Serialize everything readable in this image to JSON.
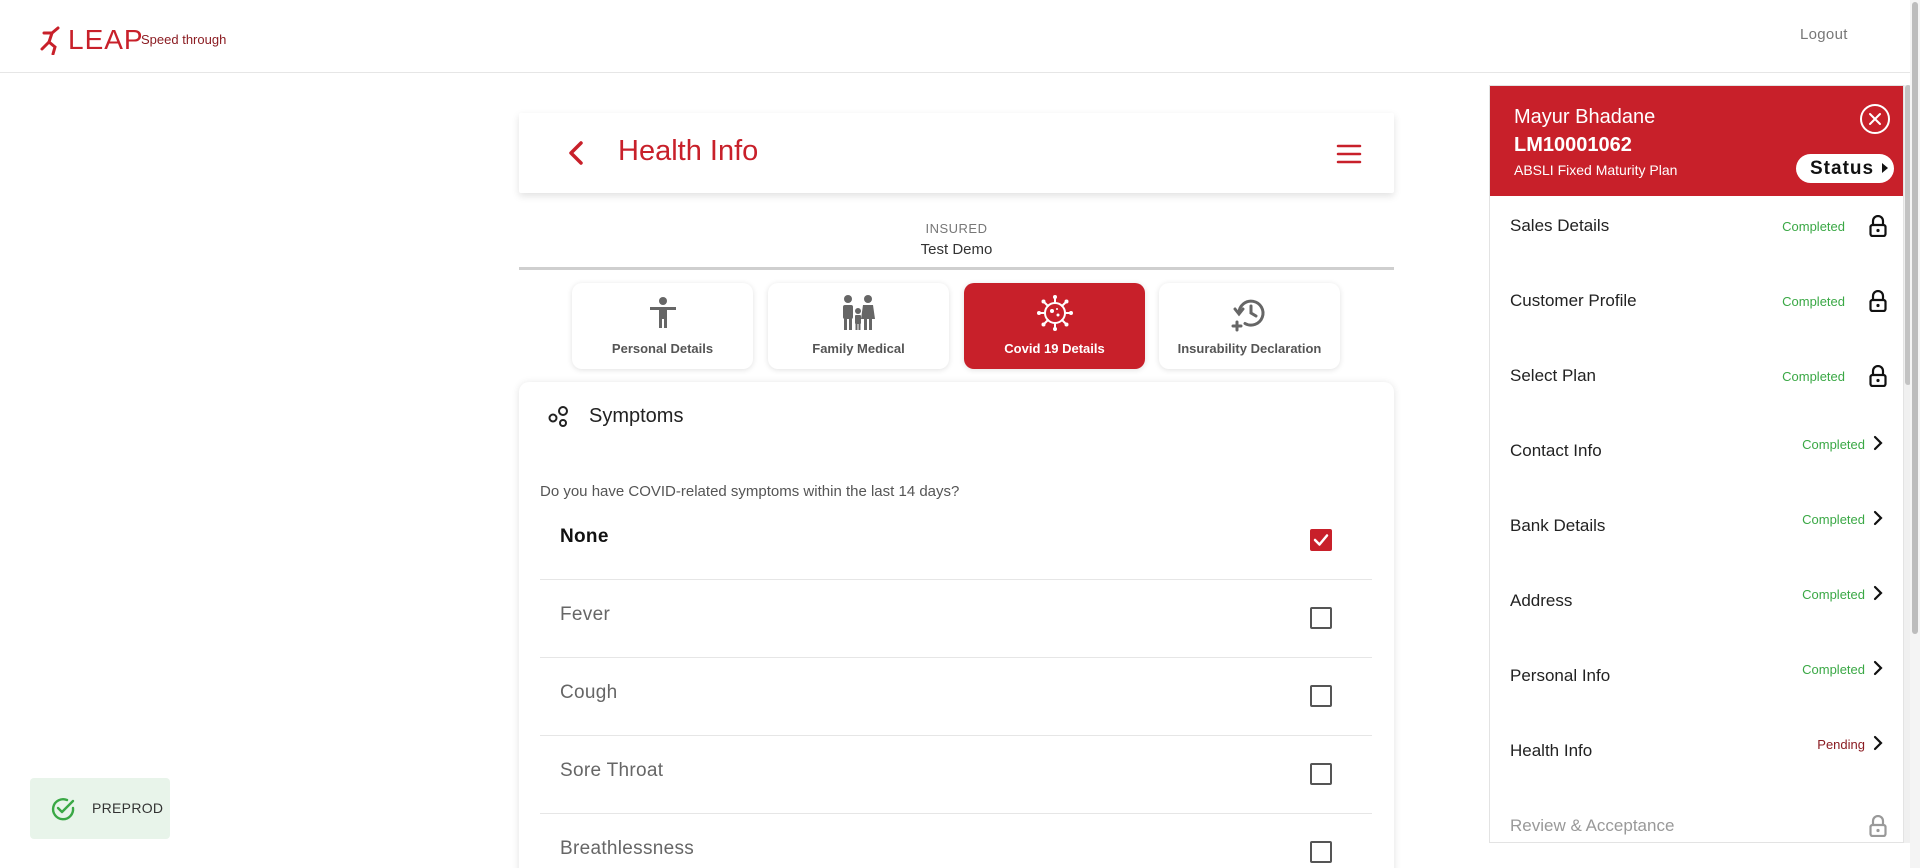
{
  "brand": {
    "name": "LEAP",
    "tagline": "Speed through",
    "accent_color": "#c8202a"
  },
  "header": {
    "logout_label": "Logout"
  },
  "page": {
    "title": "Health Info",
    "back_icon": "chevron-left-icon",
    "menu_icon": "hamburger-menu-icon",
    "insured_label": "INSURED",
    "insured_name": "Test Demo"
  },
  "tabs": [
    {
      "label": "Personal Details",
      "icon": "person-icon",
      "active": false
    },
    {
      "label": "Family Medical",
      "icon": "family-icon",
      "active": false
    },
    {
      "label": "Covid 19 Details",
      "icon": "virus-icon",
      "active": true
    },
    {
      "label": "Insurability Declaration",
      "icon": "history-add-icon",
      "active": false
    }
  ],
  "symptoms": {
    "title": "Symptoms",
    "question": "Do you have COVID-related symptoms within the last 14 days?",
    "options": [
      {
        "label": "None",
        "checked": true
      },
      {
        "label": "Fever",
        "checked": false
      },
      {
        "label": "Cough",
        "checked": false
      },
      {
        "label": "Sore Throat",
        "checked": false
      },
      {
        "label": "Breathlessness",
        "checked": false
      }
    ]
  },
  "sidebar": {
    "customer_name": "Mayur Bhadane",
    "customer_id": "LM10001062",
    "plan_name": "ABSLI Fixed Maturity Plan",
    "status_label": "Status",
    "steps": [
      {
        "label": "Sales Details",
        "status": "Completed",
        "end_icon": "lock-icon"
      },
      {
        "label": "Customer Profile",
        "status": "Completed",
        "end_icon": "lock-icon"
      },
      {
        "label": "Select Plan",
        "status": "Completed",
        "end_icon": "lock-icon"
      },
      {
        "label": "Contact Info",
        "status": "Completed",
        "end_icon": "chevron-right-icon"
      },
      {
        "label": "Bank Details",
        "status": "Completed",
        "end_icon": "chevron-right-icon"
      },
      {
        "label": "Address",
        "status": "Completed",
        "end_icon": "chevron-right-icon"
      },
      {
        "label": "Personal Info",
        "status": "Completed",
        "end_icon": "chevron-right-icon"
      },
      {
        "label": "Health Info",
        "status": "Pending",
        "end_icon": "chevron-right-icon"
      },
      {
        "label": "Review & Acceptance",
        "status": "",
        "end_icon": "lock-icon"
      }
    ]
  },
  "environment": {
    "label": "PREPROD",
    "icon": "check-circle-icon"
  }
}
